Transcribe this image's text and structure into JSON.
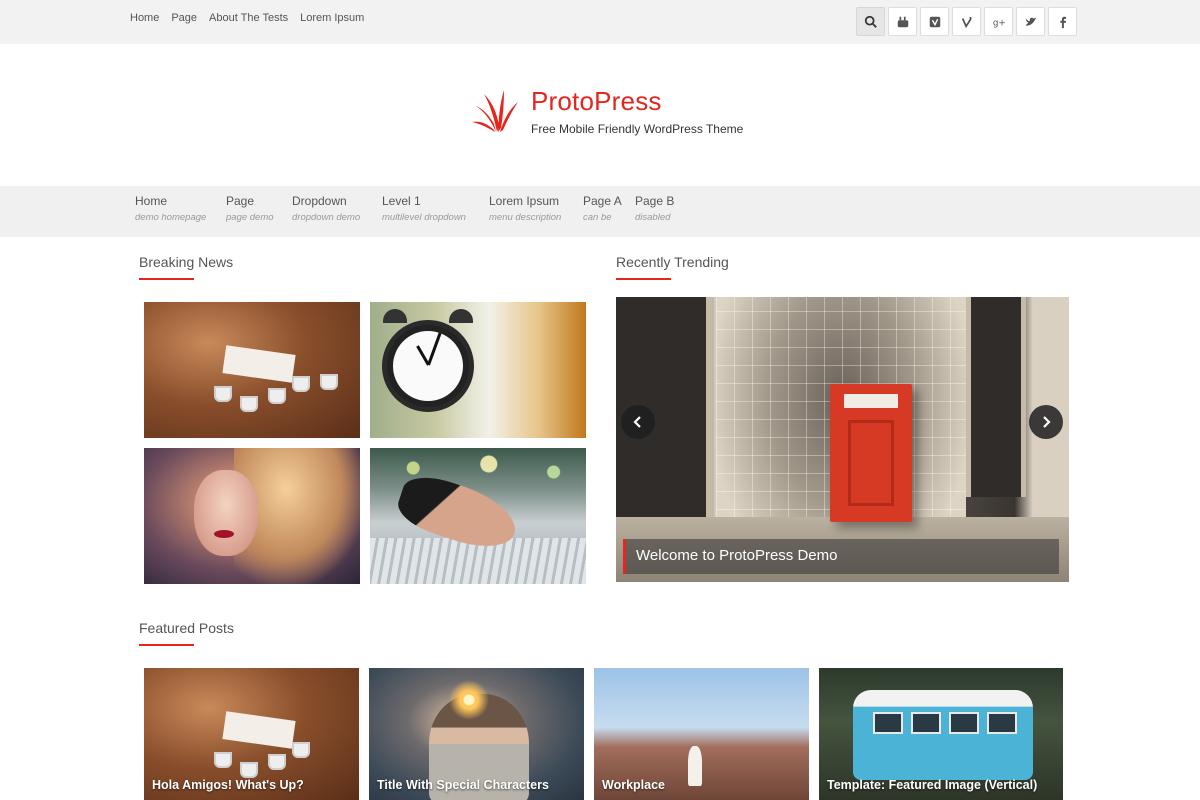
{
  "topbar": {
    "links": [
      "Home",
      "Page",
      "About The Tests",
      "Lorem Ipsum"
    ],
    "social_icons": [
      "search-icon",
      "youtube-icon",
      "vimeo-icon",
      "vine-icon",
      "google-plus-icon",
      "twitter-icon",
      "facebook-icon"
    ]
  },
  "header": {
    "site_title": "ProtoPress",
    "tagline": "Free Mobile Friendly WordPress Theme"
  },
  "nav": {
    "items": [
      {
        "label": "Home",
        "desc": "demo homepage"
      },
      {
        "label": "Page",
        "desc": "page demo"
      },
      {
        "label": "Dropdown",
        "desc": "dropdown demo"
      },
      {
        "label": "Level 1",
        "desc": "multilevel dropdown"
      },
      {
        "label": "Lorem Ipsum",
        "desc": "menu description"
      },
      {
        "label": "Page A",
        "desc": "can be"
      },
      {
        "label": "Page B",
        "desc": "disabled"
      }
    ]
  },
  "sections": {
    "breaking": "Breaking News",
    "trending": "Recently Trending",
    "featured": "Featured Posts"
  },
  "slider": {
    "caption": "Welcome to ProtoPress Demo"
  },
  "featured": [
    {
      "title": "Hola Amigos! What's Up?"
    },
    {
      "title": "Title With Special Characters"
    },
    {
      "title": "Workplace"
    },
    {
      "title": "Template: Featured Image (Vertical)"
    }
  ],
  "colors": {
    "accent": "#e5261f",
    "topbar_bg": "#f2f2f2",
    "nav_bg": "#f0f0f0"
  }
}
